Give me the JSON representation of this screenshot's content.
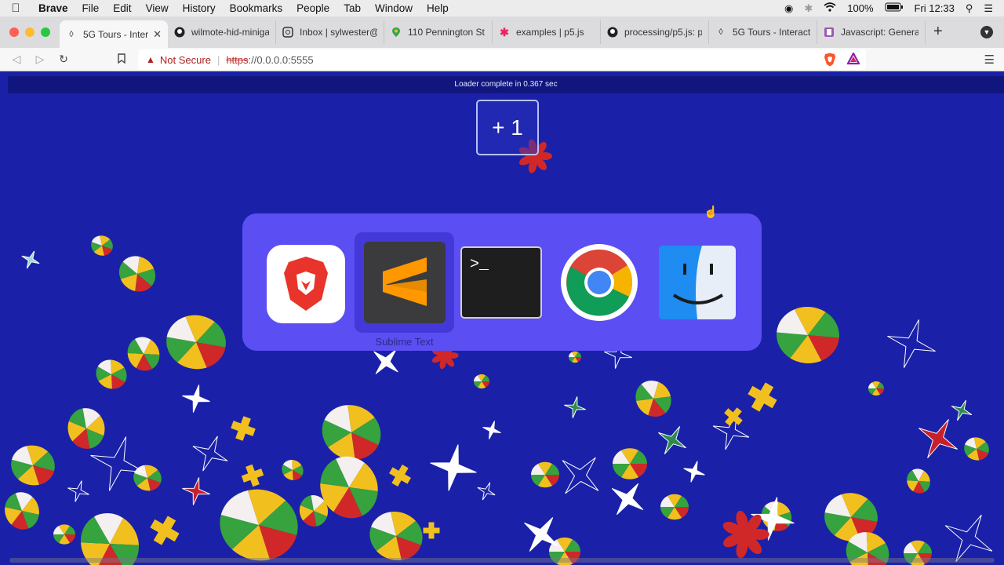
{
  "menubar": {
    "items": [
      "Brave",
      "File",
      "Edit",
      "View",
      "History",
      "Bookmarks",
      "People",
      "Tab",
      "Window",
      "Help"
    ],
    "battery": "100%",
    "clock": "Fri 12:33"
  },
  "tabs": [
    {
      "label": "5G Tours - Inter",
      "active": true,
      "favicon": "globe-icon"
    },
    {
      "label": "wilmote-hid-miniga",
      "favicon": "github-icon"
    },
    {
      "label": "Inbox | sylwester@",
      "favicon": "mail-icon"
    },
    {
      "label": "110 Pennington St -",
      "favicon": "map-pin-icon"
    },
    {
      "label": "examples | p5.js",
      "favicon": "p5-asterisk-icon"
    },
    {
      "label": "processing/p5.js: p",
      "favicon": "github-icon"
    },
    {
      "label": "5G Tours - Interact",
      "favicon": "globe-icon"
    },
    {
      "label": "Javascript: Genera",
      "favicon": "bookmark-icon"
    }
  ],
  "address": {
    "security": "Not Secure",
    "protocol": "https",
    "rest": "://0.0.0.0:5555"
  },
  "page": {
    "loader_text": "Loader complete in 0.367 sec",
    "counter": "+ 1"
  },
  "switcher": {
    "selected_label": "Sublime Text",
    "apps": [
      "brave-icon",
      "sublime-text-icon",
      "terminal-icon",
      "chrome-icon",
      "finder-icon"
    ]
  },
  "colors": {
    "page_bg": "#1a21a8",
    "switcher_bg": "#5b4ef2",
    "confetti_red": "#d02828",
    "confetti_yellow": "#f2c01e",
    "confetti_green": "#36a33e"
  }
}
